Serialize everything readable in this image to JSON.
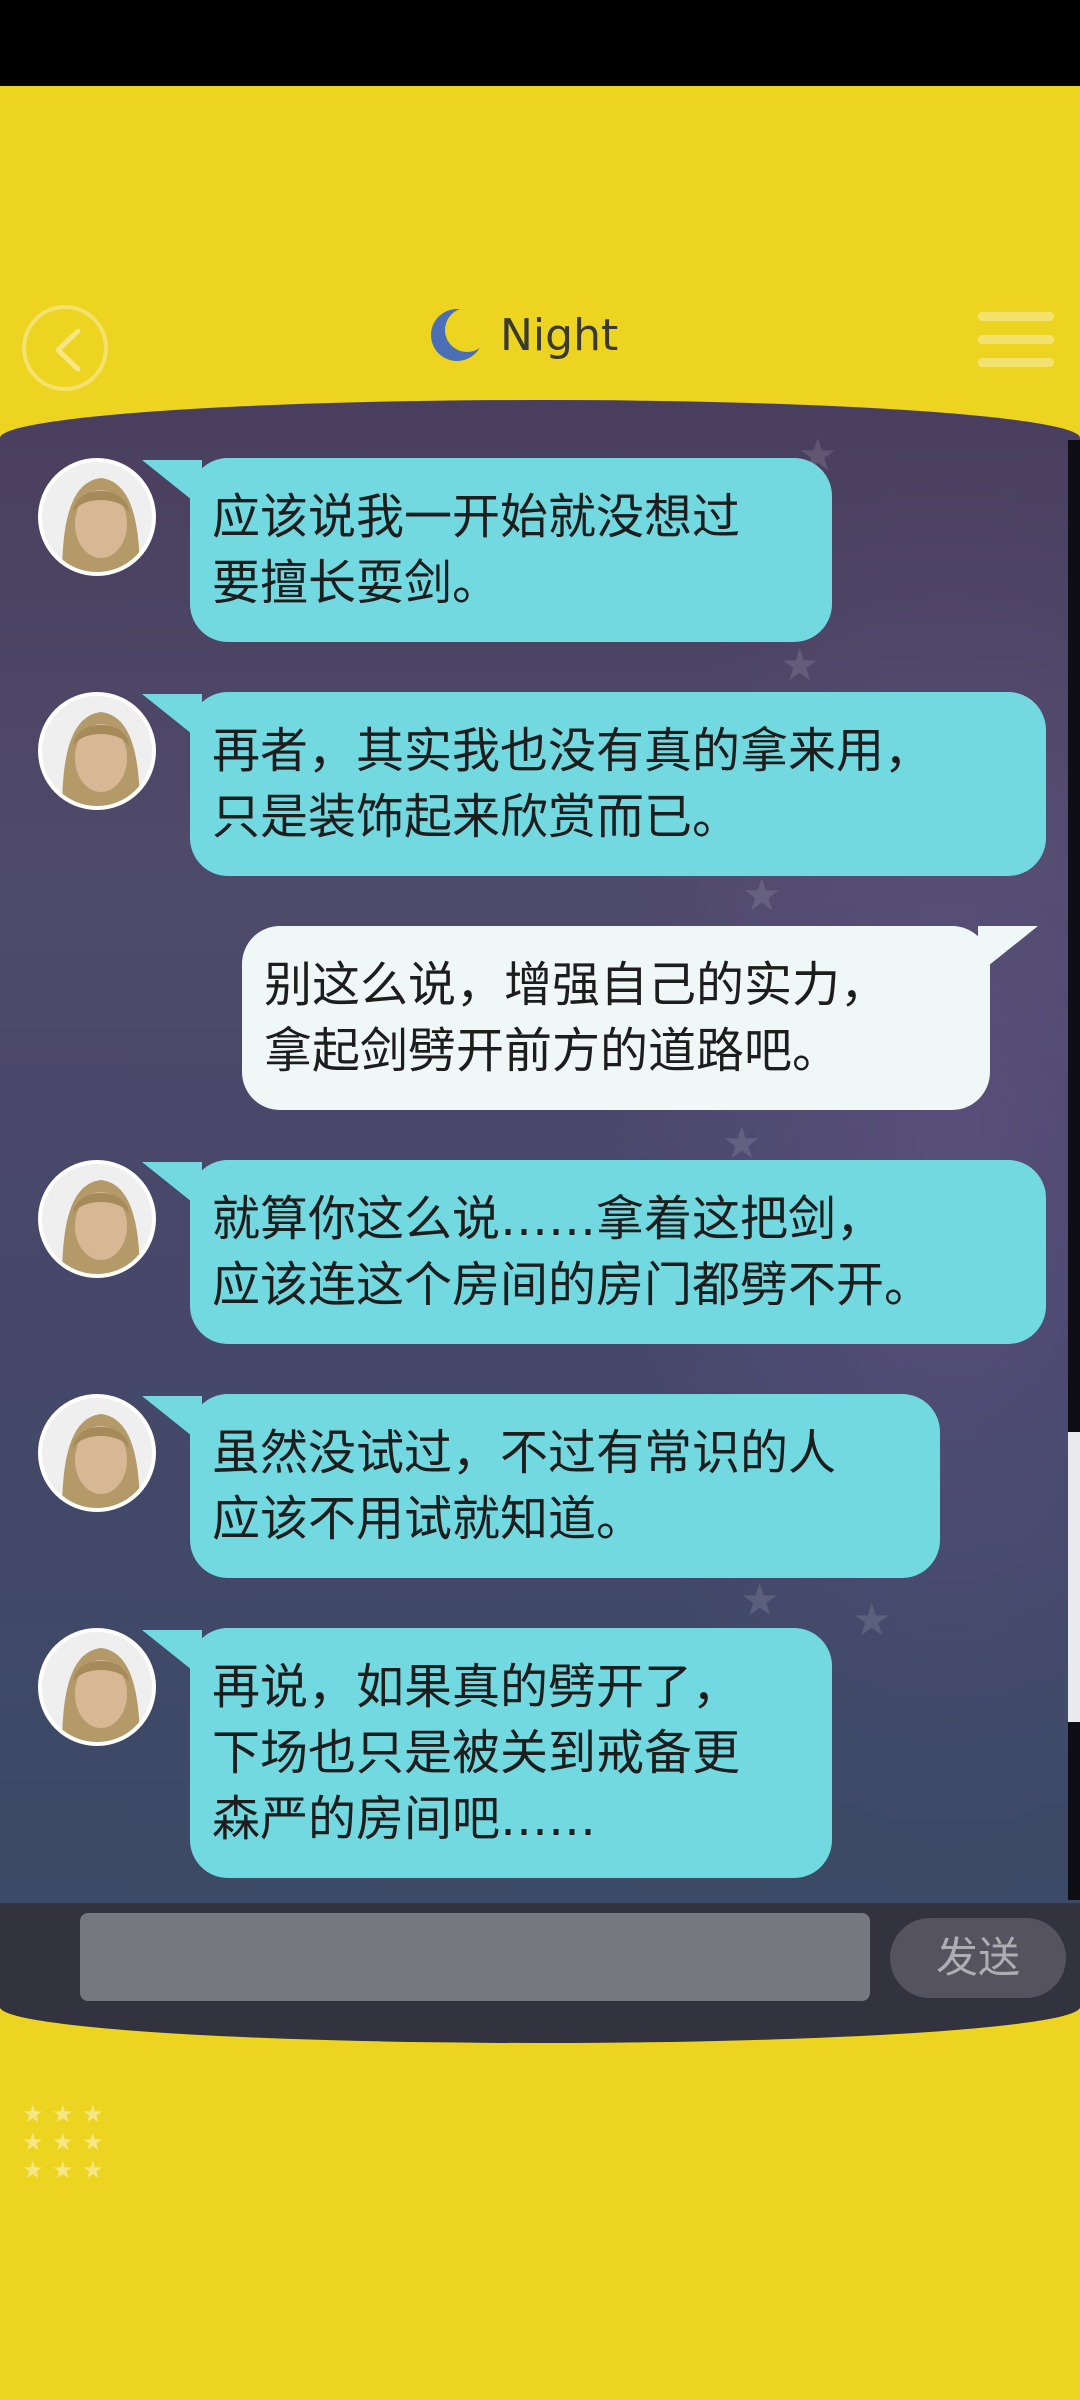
{
  "header": {
    "title": "Night",
    "back_icon": "chevron-left-icon",
    "menu_icon": "hamburger-icon",
    "moon_icon": "moon-icon"
  },
  "messages": [
    {
      "side": "left",
      "text": "应该说我一开始就没想过\n要擅长耍剑。"
    },
    {
      "side": "left",
      "text": "再者，其实我也没有真的拿来用，\n只是装饰起来欣赏而已。"
    },
    {
      "side": "right",
      "text": "别这么说，增强自己的实力，\n拿起剑劈开前方的道路吧。"
    },
    {
      "side": "left",
      "text": "就算你这么说……拿着这把剑，\n应该连这个房间的房门都劈不开。"
    },
    {
      "side": "left",
      "text": "虽然没试过，不过有常识的人\n应该不用试就知道。"
    },
    {
      "side": "left",
      "text": "再说，如果真的劈开了，\n下场也只是被关到戒备更\n森严的房间吧……"
    }
  ],
  "composer": {
    "input_value": "",
    "send_label": "发送"
  },
  "colors": {
    "background": "#EDD421",
    "bubble_left": "#72D9E0",
    "bubble_right": "#EFF7F7"
  }
}
